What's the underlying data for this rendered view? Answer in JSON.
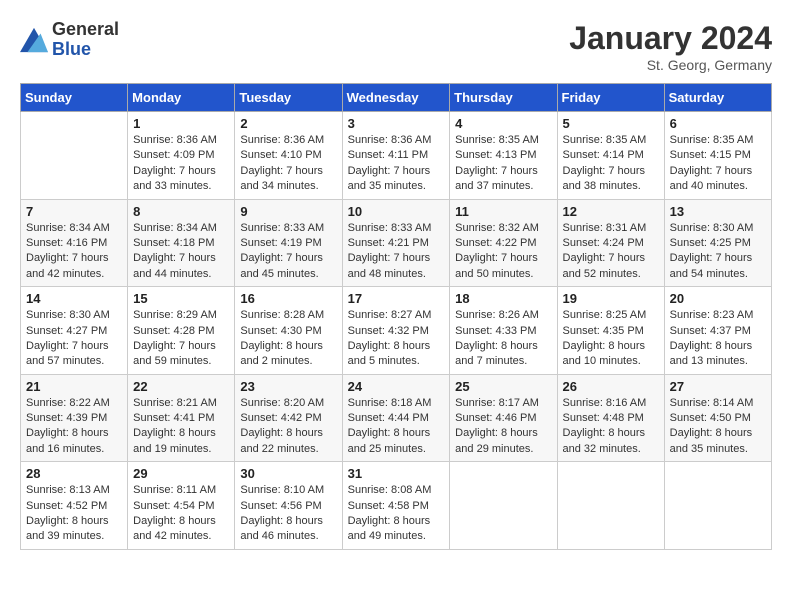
{
  "logo": {
    "general": "General",
    "blue": "Blue"
  },
  "title": "January 2024",
  "subtitle": "St. Georg, Germany",
  "days_of_week": [
    "Sunday",
    "Monday",
    "Tuesday",
    "Wednesday",
    "Thursday",
    "Friday",
    "Saturday"
  ],
  "weeks": [
    [
      {
        "day": "",
        "sunrise": "",
        "sunset": "",
        "daylight": ""
      },
      {
        "day": "1",
        "sunrise": "Sunrise: 8:36 AM",
        "sunset": "Sunset: 4:09 PM",
        "daylight": "Daylight: 7 hours and 33 minutes."
      },
      {
        "day": "2",
        "sunrise": "Sunrise: 8:36 AM",
        "sunset": "Sunset: 4:10 PM",
        "daylight": "Daylight: 7 hours and 34 minutes."
      },
      {
        "day": "3",
        "sunrise": "Sunrise: 8:36 AM",
        "sunset": "Sunset: 4:11 PM",
        "daylight": "Daylight: 7 hours and 35 minutes."
      },
      {
        "day": "4",
        "sunrise": "Sunrise: 8:35 AM",
        "sunset": "Sunset: 4:13 PM",
        "daylight": "Daylight: 7 hours and 37 minutes."
      },
      {
        "day": "5",
        "sunrise": "Sunrise: 8:35 AM",
        "sunset": "Sunset: 4:14 PM",
        "daylight": "Daylight: 7 hours and 38 minutes."
      },
      {
        "day": "6",
        "sunrise": "Sunrise: 8:35 AM",
        "sunset": "Sunset: 4:15 PM",
        "daylight": "Daylight: 7 hours and 40 minutes."
      }
    ],
    [
      {
        "day": "7",
        "sunrise": "Sunrise: 8:34 AM",
        "sunset": "Sunset: 4:16 PM",
        "daylight": "Daylight: 7 hours and 42 minutes."
      },
      {
        "day": "8",
        "sunrise": "Sunrise: 8:34 AM",
        "sunset": "Sunset: 4:18 PM",
        "daylight": "Daylight: 7 hours and 44 minutes."
      },
      {
        "day": "9",
        "sunrise": "Sunrise: 8:33 AM",
        "sunset": "Sunset: 4:19 PM",
        "daylight": "Daylight: 7 hours and 45 minutes."
      },
      {
        "day": "10",
        "sunrise": "Sunrise: 8:33 AM",
        "sunset": "Sunset: 4:21 PM",
        "daylight": "Daylight: 7 hours and 48 minutes."
      },
      {
        "day": "11",
        "sunrise": "Sunrise: 8:32 AM",
        "sunset": "Sunset: 4:22 PM",
        "daylight": "Daylight: 7 hours and 50 minutes."
      },
      {
        "day": "12",
        "sunrise": "Sunrise: 8:31 AM",
        "sunset": "Sunset: 4:24 PM",
        "daylight": "Daylight: 7 hours and 52 minutes."
      },
      {
        "day": "13",
        "sunrise": "Sunrise: 8:30 AM",
        "sunset": "Sunset: 4:25 PM",
        "daylight": "Daylight: 7 hours and 54 minutes."
      }
    ],
    [
      {
        "day": "14",
        "sunrise": "Sunrise: 8:30 AM",
        "sunset": "Sunset: 4:27 PM",
        "daylight": "Daylight: 7 hours and 57 minutes."
      },
      {
        "day": "15",
        "sunrise": "Sunrise: 8:29 AM",
        "sunset": "Sunset: 4:28 PM",
        "daylight": "Daylight: 7 hours and 59 minutes."
      },
      {
        "day": "16",
        "sunrise": "Sunrise: 8:28 AM",
        "sunset": "Sunset: 4:30 PM",
        "daylight": "Daylight: 8 hours and 2 minutes."
      },
      {
        "day": "17",
        "sunrise": "Sunrise: 8:27 AM",
        "sunset": "Sunset: 4:32 PM",
        "daylight": "Daylight: 8 hours and 5 minutes."
      },
      {
        "day": "18",
        "sunrise": "Sunrise: 8:26 AM",
        "sunset": "Sunset: 4:33 PM",
        "daylight": "Daylight: 8 hours and 7 minutes."
      },
      {
        "day": "19",
        "sunrise": "Sunrise: 8:25 AM",
        "sunset": "Sunset: 4:35 PM",
        "daylight": "Daylight: 8 hours and 10 minutes."
      },
      {
        "day": "20",
        "sunrise": "Sunrise: 8:23 AM",
        "sunset": "Sunset: 4:37 PM",
        "daylight": "Daylight: 8 hours and 13 minutes."
      }
    ],
    [
      {
        "day": "21",
        "sunrise": "Sunrise: 8:22 AM",
        "sunset": "Sunset: 4:39 PM",
        "daylight": "Daylight: 8 hours and 16 minutes."
      },
      {
        "day": "22",
        "sunrise": "Sunrise: 8:21 AM",
        "sunset": "Sunset: 4:41 PM",
        "daylight": "Daylight: 8 hours and 19 minutes."
      },
      {
        "day": "23",
        "sunrise": "Sunrise: 8:20 AM",
        "sunset": "Sunset: 4:42 PM",
        "daylight": "Daylight: 8 hours and 22 minutes."
      },
      {
        "day": "24",
        "sunrise": "Sunrise: 8:18 AM",
        "sunset": "Sunset: 4:44 PM",
        "daylight": "Daylight: 8 hours and 25 minutes."
      },
      {
        "day": "25",
        "sunrise": "Sunrise: 8:17 AM",
        "sunset": "Sunset: 4:46 PM",
        "daylight": "Daylight: 8 hours and 29 minutes."
      },
      {
        "day": "26",
        "sunrise": "Sunrise: 8:16 AM",
        "sunset": "Sunset: 4:48 PM",
        "daylight": "Daylight: 8 hours and 32 minutes."
      },
      {
        "day": "27",
        "sunrise": "Sunrise: 8:14 AM",
        "sunset": "Sunset: 4:50 PM",
        "daylight": "Daylight: 8 hours and 35 minutes."
      }
    ],
    [
      {
        "day": "28",
        "sunrise": "Sunrise: 8:13 AM",
        "sunset": "Sunset: 4:52 PM",
        "daylight": "Daylight: 8 hours and 39 minutes."
      },
      {
        "day": "29",
        "sunrise": "Sunrise: 8:11 AM",
        "sunset": "Sunset: 4:54 PM",
        "daylight": "Daylight: 8 hours and 42 minutes."
      },
      {
        "day": "30",
        "sunrise": "Sunrise: 8:10 AM",
        "sunset": "Sunset: 4:56 PM",
        "daylight": "Daylight: 8 hours and 46 minutes."
      },
      {
        "day": "31",
        "sunrise": "Sunrise: 8:08 AM",
        "sunset": "Sunset: 4:58 PM",
        "daylight": "Daylight: 8 hours and 49 minutes."
      },
      {
        "day": "",
        "sunrise": "",
        "sunset": "",
        "daylight": ""
      },
      {
        "day": "",
        "sunrise": "",
        "sunset": "",
        "daylight": ""
      },
      {
        "day": "",
        "sunrise": "",
        "sunset": "",
        "daylight": ""
      }
    ]
  ]
}
